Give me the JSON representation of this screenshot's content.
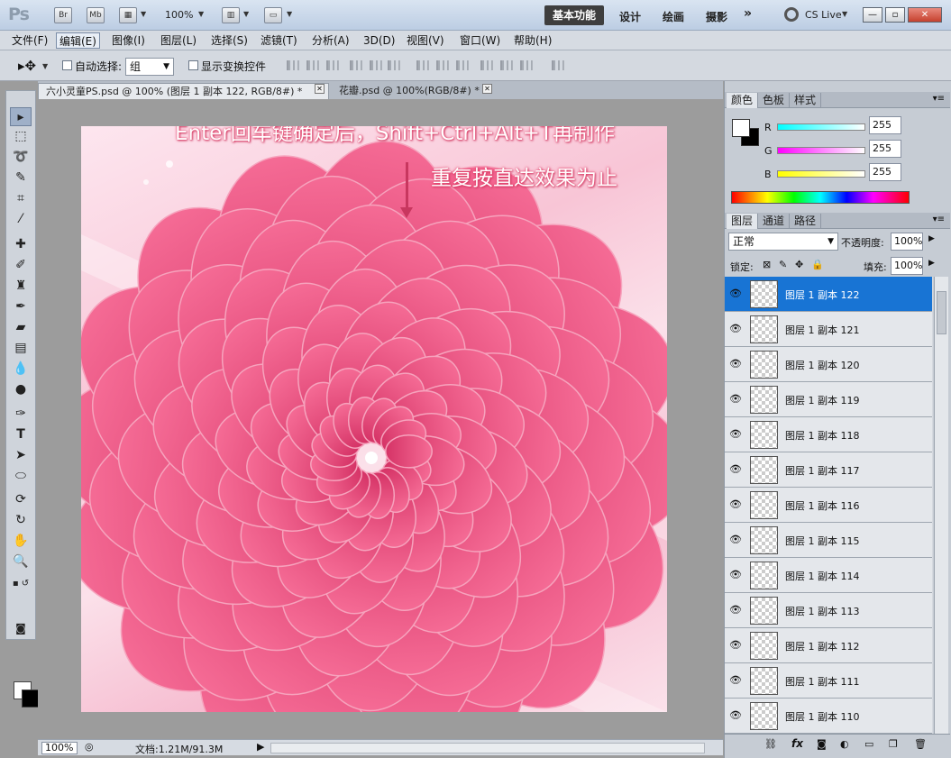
{
  "app": {
    "logo": "Ps",
    "bridge_btn": "Br",
    "minibridge_btn": "Mb",
    "zoom": "100%",
    "workspaces": [
      "设计",
      "绘画",
      "摄影"
    ],
    "active_workspace": "基本功能",
    "more": "»",
    "cslive": "CS Live"
  },
  "menu": [
    "文件(F)",
    "编辑(E)",
    "图像(I)",
    "图层(L)",
    "选择(S)",
    "滤镜(T)",
    "分析(A)",
    "3D(D)",
    "视图(V)",
    "窗口(W)",
    "帮助(H)"
  ],
  "options": {
    "auto_select_label": "自动选择:",
    "auto_select_value": "组",
    "show_transform_label": "显示变换控件"
  },
  "tabs": [
    {
      "title": "六小灵童PS.psd @ 100% (图层 1 副本 122, RGB/8#) *"
    },
    {
      "title": "花瓣.psd @ 100%(RGB/8#) *"
    }
  ],
  "annotation": {
    "line1": "Enter回车键确定后，Shift+Ctrl+Alt+T再制作",
    "line2": "重复按直达效果为止"
  },
  "status": {
    "zoom": "100%",
    "doc": "文档:1.21M/91.3M"
  },
  "color_panel": {
    "tabs": [
      "颜色",
      "色板",
      "样式"
    ],
    "r_label": "R",
    "g_label": "G",
    "b_label": "B",
    "r": "255",
    "g": "255",
    "b": "255"
  },
  "layers_panel": {
    "tabs": [
      "图层",
      "通道",
      "路径"
    ],
    "blend_mode": "正常",
    "opacity_label": "不透明度:",
    "opacity": "100%",
    "lock_label": "锁定:",
    "fill_label": "填充:",
    "fill": "100%",
    "layers": [
      {
        "name": "图层 1 副本 122",
        "active": true
      },
      {
        "name": "图层 1 副本 121"
      },
      {
        "name": "图层 1 副本 120"
      },
      {
        "name": "图层 1 副本 119"
      },
      {
        "name": "图层 1 副本 118"
      },
      {
        "name": "图层 1 副本 117"
      },
      {
        "name": "图层 1 副本 116"
      },
      {
        "name": "图层 1 副本 115"
      },
      {
        "name": "图层 1 副本 114"
      },
      {
        "name": "图层 1 副本 113"
      },
      {
        "name": "图层 1 副本 112"
      },
      {
        "name": "图层 1 副本 111"
      },
      {
        "name": "图层 1 副本 110"
      }
    ]
  },
  "colors": {
    "selection": "#1874d4",
    "petal": "#e8457a",
    "petal_dark": "#c92a5d"
  }
}
